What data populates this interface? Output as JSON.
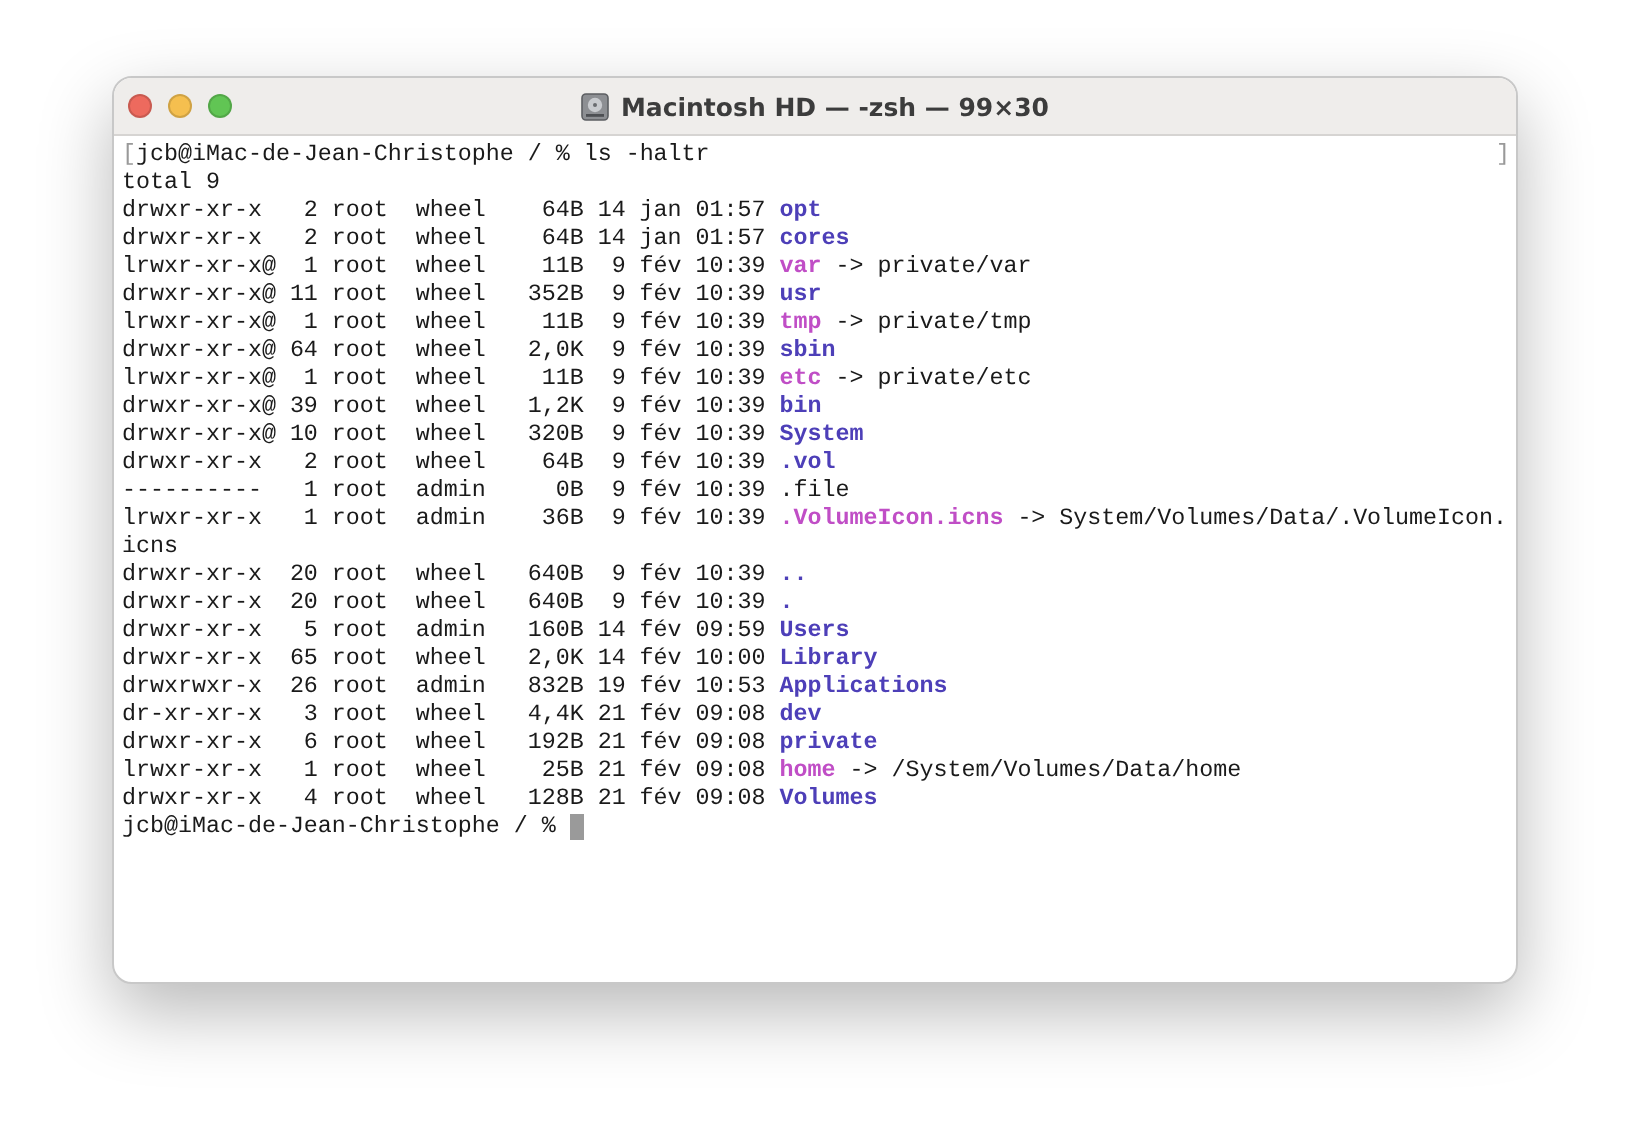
{
  "window": {
    "title": "Macintosh HD — -zsh — 99×30"
  },
  "terminal": {
    "lines": [
      {
        "kind": "prompt",
        "text": "jcb@iMac-de-Jean-Christophe / % ls -haltr",
        "mark_open": "[",
        "mark_close": "]",
        "cursor": false
      },
      {
        "kind": "text",
        "text": "total 9"
      },
      {
        "kind": "entry",
        "meta": "drwxr-xr-x   2 root  wheel    64B 14 jan 01:57",
        "name": "opt",
        "color": "#4d3fb8",
        "bold": true
      },
      {
        "kind": "entry",
        "meta": "drwxr-xr-x   2 root  wheel    64B 14 jan 01:57",
        "name": "cores",
        "color": "#4d3fb8",
        "bold": true
      },
      {
        "kind": "entry",
        "meta": "lrwxr-xr-x@  1 root  wheel    11B  9 fév 10:39",
        "name": "var",
        "color": "#c04ec6",
        "bold": true,
        "target": "-> private/var"
      },
      {
        "kind": "entry",
        "meta": "drwxr-xr-x@ 11 root  wheel   352B  9 fév 10:39",
        "name": "usr",
        "color": "#4d3fb8",
        "bold": true
      },
      {
        "kind": "entry",
        "meta": "lrwxr-xr-x@  1 root  wheel    11B  9 fév 10:39",
        "name": "tmp",
        "color": "#c04ec6",
        "bold": true,
        "target": "-> private/tmp"
      },
      {
        "kind": "entry",
        "meta": "drwxr-xr-x@ 64 root  wheel   2,0K  9 fév 10:39",
        "name": "sbin",
        "color": "#4d3fb8",
        "bold": true
      },
      {
        "kind": "entry",
        "meta": "lrwxr-xr-x@  1 root  wheel    11B  9 fév 10:39",
        "name": "etc",
        "color": "#c04ec6",
        "bold": true,
        "target": "-> private/etc"
      },
      {
        "kind": "entry",
        "meta": "drwxr-xr-x@ 39 root  wheel   1,2K  9 fév 10:39",
        "name": "bin",
        "color": "#4d3fb8",
        "bold": true
      },
      {
        "kind": "entry",
        "meta": "drwxr-xr-x@ 10 root  wheel   320B  9 fév 10:39",
        "name": "System",
        "color": "#4d3fb8",
        "bold": true
      },
      {
        "kind": "entry",
        "meta": "drwxr-xr-x   2 root  wheel    64B  9 fév 10:39",
        "name": ".vol",
        "color": "#4d3fb8",
        "bold": true
      },
      {
        "kind": "entry",
        "meta": "----------   1 root  admin     0B  9 fév 10:39",
        "name": ".file",
        "color": "#1a1a1a",
        "bold": false
      },
      {
        "kind": "entry",
        "meta": "lrwxr-xr-x   1 root  admin    36B  9 fév 10:39",
        "name": ".VolumeIcon.icns",
        "color": "#c04ec6",
        "bold": true,
        "target": "-> System/Volumes/Data/.VolumeIcon."
      },
      {
        "kind": "text",
        "text": "icns"
      },
      {
        "kind": "entry",
        "meta": "drwxr-xr-x  20 root  wheel   640B  9 fév 10:39",
        "name": "..",
        "color": "#4d3fb8",
        "bold": true
      },
      {
        "kind": "entry",
        "meta": "drwxr-xr-x  20 root  wheel   640B  9 fév 10:39",
        "name": ".",
        "color": "#4d3fb8",
        "bold": true
      },
      {
        "kind": "entry",
        "meta": "drwxr-xr-x   5 root  admin   160B 14 fév 09:59",
        "name": "Users",
        "color": "#4d3fb8",
        "bold": true
      },
      {
        "kind": "entry",
        "meta": "drwxr-xr-x  65 root  wheel   2,0K 14 fév 10:00",
        "name": "Library",
        "color": "#4d3fb8",
        "bold": true
      },
      {
        "kind": "entry",
        "meta": "drwxrwxr-x  26 root  admin   832B 19 fév 10:53",
        "name": "Applications",
        "color": "#4d3fb8",
        "bold": true
      },
      {
        "kind": "entry",
        "meta": "dr-xr-xr-x   3 root  wheel   4,4K 21 fév 09:08",
        "name": "dev",
        "color": "#4d3fb8",
        "bold": true
      },
      {
        "kind": "entry",
        "meta": "drwxr-xr-x   6 root  wheel   192B 21 fév 09:08",
        "name": "private",
        "color": "#4d3fb8",
        "bold": true
      },
      {
        "kind": "entry",
        "meta": "lrwxr-xr-x   1 root  wheel    25B 21 fév 09:08",
        "name": "home",
        "color": "#c04ec6",
        "bold": true,
        "target": "-> /System/Volumes/Data/home"
      },
      {
        "kind": "entry",
        "meta": "drwxr-xr-x   4 root  wheel   128B 21 fév 09:08",
        "name": "Volumes",
        "color": "#4d3fb8",
        "bold": true
      },
      {
        "kind": "prompt",
        "text": "jcb@iMac-de-Jean-Christophe / %",
        "cursor": true
      }
    ]
  }
}
